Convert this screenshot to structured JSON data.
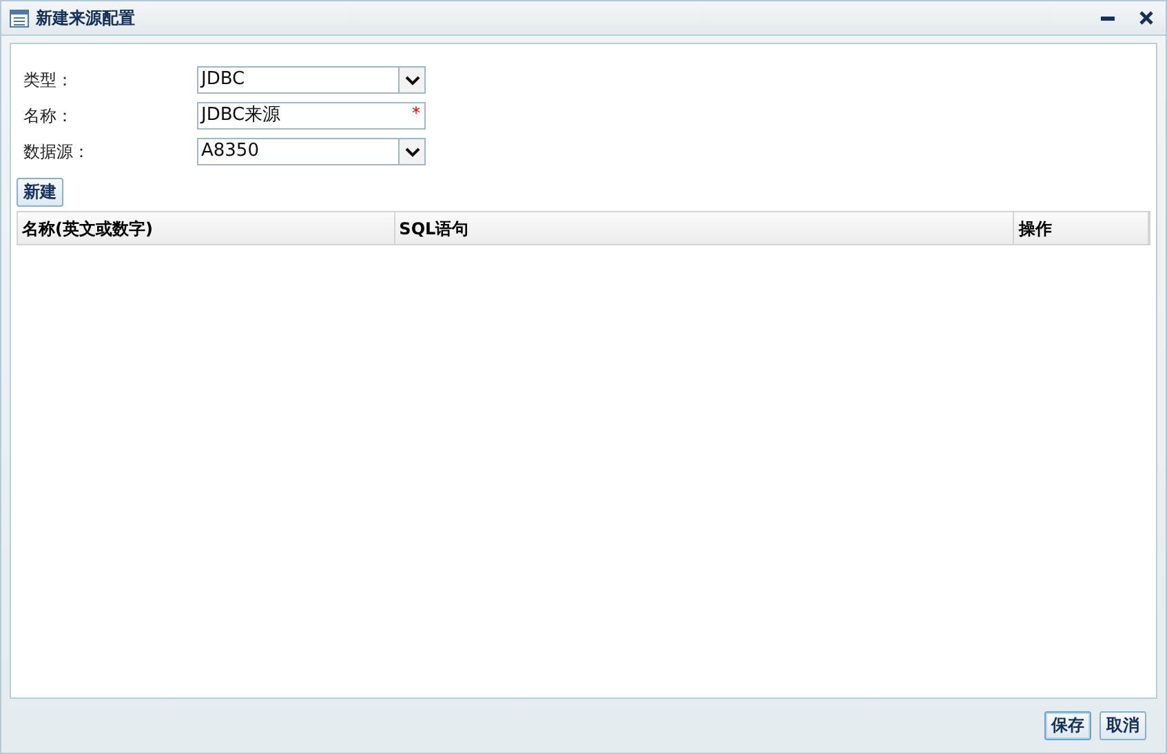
{
  "window": {
    "title": "新建来源配置"
  },
  "fields": [
    {
      "label": "类型：",
      "kind": "select",
      "value": "JDBC"
    },
    {
      "label": "名称：",
      "kind": "text",
      "value": "JDBC来源",
      "required_mark": "*"
    },
    {
      "label": "数据源：",
      "kind": "select",
      "value": "A8350"
    }
  ],
  "new_button": "新建",
  "table": {
    "columns": [
      "名称(英文或数字)",
      "SQL语句",
      "操作"
    ]
  },
  "footer_buttons": [
    {
      "label": "保存",
      "selected": true
    },
    {
      "label": "取消",
      "selected": false
    }
  ]
}
